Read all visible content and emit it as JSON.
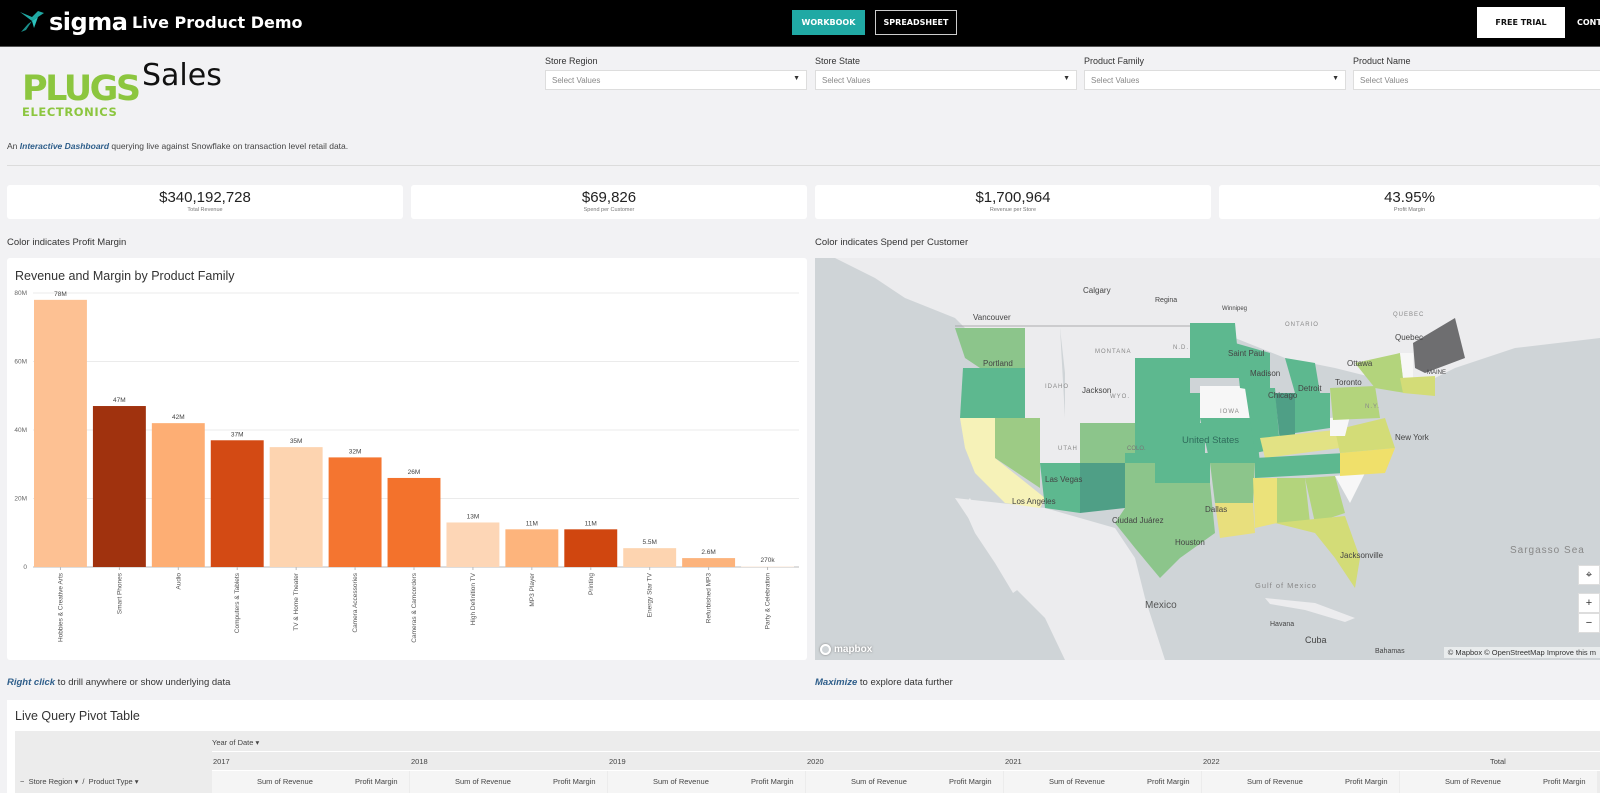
{
  "topbar": {
    "brand": "sigma",
    "app_title": "Live Product Demo",
    "workbook_label": "WORKBOOK",
    "spreadsheet_label": "SPREADSHEET",
    "free_trial_label": "FREE TRIAL",
    "contact_label": "CONTA",
    "accent_color": "#20a9a4"
  },
  "header": {
    "logo_line1": "PLUGS",
    "logo_line2": "ELECTRONICS",
    "page_title": "Sales",
    "intro_prefix": "An ",
    "intro_link": "Interactive Dashboard",
    "intro_suffix": " querying live against Snowflake on transaction level retail data."
  },
  "filters": [
    {
      "label": "Store Region",
      "placeholder": "Select Values"
    },
    {
      "label": "Store State",
      "placeholder": "Select Values"
    },
    {
      "label": "Product Family",
      "placeholder": "Select Values"
    },
    {
      "label": "Product Name",
      "placeholder": "Select Values"
    }
  ],
  "kpis": [
    {
      "value": "$340,192,728",
      "label": "Total Revenue"
    },
    {
      "value": "$69,826",
      "label": "Spend per Customer"
    },
    {
      "value": "$1,700,964",
      "label": "Revenue per Store"
    },
    {
      "value": "43.95%",
      "label": "Profit Margin"
    }
  ],
  "notes": {
    "left": "Color indicates Profit Margin",
    "right": "Color indicates Spend per Customer",
    "drill_link": "Right click",
    "drill_text": " to drill anywhere or show underlying data",
    "maximize_link": "Maximize",
    "maximize_text": " to explore data further"
  },
  "chart_data": {
    "type": "bar",
    "title": "Revenue and Margin by Product Family",
    "xlabel": "",
    "ylabel": "",
    "ylim": [
      0,
      80000000
    ],
    "yticks": [
      0,
      20000000,
      40000000,
      60000000,
      80000000
    ],
    "ytick_labels": [
      "0",
      "20M",
      "40M",
      "60M",
      "80M"
    ],
    "grid": true,
    "categories": [
      "Hobbies & Creative Arts",
      "Smart Phones",
      "Audio",
      "Computers & Tablets",
      "TV & Home Theater",
      "Camera Accessories",
      "Cameras & Camcorders",
      "High Definition TV",
      "MP3 Player",
      "Printing",
      "Energy Star TV",
      "Refurbished MP3",
      "Party & Celebration"
    ],
    "values": [
      78000000,
      47000000,
      42000000,
      37000000,
      35000000,
      32000000,
      26000000,
      13000000,
      11000000,
      11000000,
      5500000,
      2600000,
      270000
    ],
    "data_labels": [
      "78M",
      "47M",
      "42M",
      "37M",
      "35M",
      "32M",
      "26M",
      "13M",
      "11M",
      "11M",
      "5.5M",
      "2.6M",
      "270k"
    ],
    "colors": [
      "#fdc193",
      "#a0320e",
      "#fdae74",
      "#d34a14",
      "#fdd4b0",
      "#f47530",
      "#f3722c",
      "#fdd6b6",
      "#fdb47c",
      "#d0460f",
      "#fdd4b0",
      "#fcb37c",
      "#fef2e8"
    ],
    "color_encodes": "Profit Margin"
  },
  "map": {
    "labels": [
      "Calgary",
      "Regina",
      "Winnipeg",
      "Vancouver",
      "Portland",
      "MONTANA",
      "N.D.",
      "IDAHO",
      "Jackson",
      "WYO.",
      "UTAH",
      "COLO.",
      "United States",
      "IOWA",
      "Chicago",
      "Madison",
      "Saint Paul",
      "Detroit",
      "Toronto",
      "Ottawa",
      "Quebec",
      "QUEBEC",
      "ONTARIO",
      "N.Y.",
      "New York",
      "MAINE",
      "Las Vegas",
      "Los Angeles",
      "Ciudad Juárez",
      "Dallas",
      "Houston",
      "Jacksonville",
      "Mexico",
      "Gulf of Mexico",
      "Havana",
      "Cuba",
      "Bahamas",
      "Sargasso Sea"
    ],
    "attribution": "© Mapbox © OpenStreetMap  Improve this m",
    "brand": "mapbox",
    "color_encodes": "Spend per Customer"
  },
  "pivot": {
    "title": "Live Query Pivot Table",
    "column_group": "Year of Date",
    "row_fields": [
      "Store Region",
      "Product Type"
    ],
    "years": [
      "2017",
      "2018",
      "2019",
      "2020",
      "2021",
      "2022",
      "Total"
    ],
    "measures": [
      "Sum of Revenue",
      "Profit Margin"
    ]
  }
}
